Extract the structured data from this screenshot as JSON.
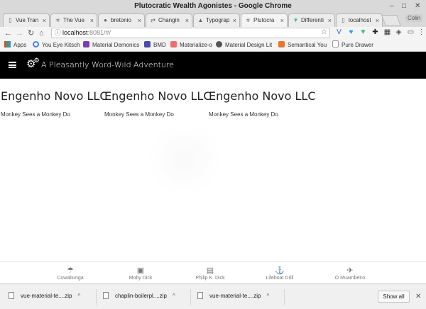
{
  "window": {
    "title": "Plutocratic Wealth Agonistes - Google Chrome",
    "min": "–",
    "max": "□",
    "close": "✕"
  },
  "tabs": [
    {
      "label": "Vue Tran",
      "icon": "page-icon",
      "glyph": "▯"
    },
    {
      "label": "The Vue",
      "icon": "biohazard-icon",
      "glyph": "☣"
    },
    {
      "label": "bretonio",
      "icon": "github-icon",
      "glyph": "●"
    },
    {
      "label": "Changin",
      "icon": "swap-icon",
      "glyph": "⇄"
    },
    {
      "label": "Typograp",
      "icon": "type-icon",
      "glyph": "▲"
    },
    {
      "label": "Plutocra",
      "icon": "biohazard-icon",
      "glyph": "☣"
    },
    {
      "label": "Differenti",
      "icon": "vue-icon",
      "glyph": "▼"
    },
    {
      "label": "localhost",
      "icon": "page-icon",
      "glyph": "▯"
    }
  ],
  "user_button": "Colin",
  "address": {
    "host": "localhost",
    "path": ":8081/#/"
  },
  "bookmarks": [
    {
      "label": "Apps",
      "icon": "apps-grid-icon",
      "color": "#e94235"
    },
    {
      "label": "You Eye Kitsch",
      "icon": "spinner-icon",
      "color": "#4285f4"
    },
    {
      "label": "Material Demonics",
      "icon": "material-icon",
      "color": "#7b3fb0"
    },
    {
      "label": "BMD",
      "icon": "bmd-icon",
      "color": "#4a4aa8"
    },
    {
      "label": "Materialize-o",
      "icon": "materialize-icon",
      "color": "#ee6e73"
    },
    {
      "label": "Material Design Lit",
      "icon": "md-lite-icon",
      "color": "#555555"
    },
    {
      "label": "Semantical You",
      "icon": "semantic-icon",
      "color": "#e8742f"
    },
    {
      "label": "Pure Drawer",
      "icon": "page-icon",
      "color": "#dddddd"
    }
  ],
  "app": {
    "title": "A Pleasantly Word-Wild Adventure"
  },
  "cards": [
    {
      "company": "Engenho Novo LLC",
      "tagline": "Monkey Sees a Monkey Do"
    },
    {
      "company": "Engenho Novo LLC",
      "tagline": "Monkey Sees a Monkey Do"
    },
    {
      "company": "Engenho Novo LLC",
      "tagline": "Monkey Sees a Monkey Do"
    }
  ],
  "bottom_nav": [
    {
      "label": "Cowabunga",
      "icon": "umbrella-icon",
      "glyph": "☂"
    },
    {
      "label": "Moby Dick",
      "icon": "bus-icon",
      "glyph": "▣"
    },
    {
      "label": "Philip K. Dick",
      "icon": "book-icon",
      "glyph": "▤"
    },
    {
      "label": "Lifeboat Drill",
      "icon": "rowing-icon",
      "glyph": "⚓"
    },
    {
      "label": "O Muambeiro",
      "icon": "airplane-icon",
      "glyph": "✈"
    }
  ],
  "downloads": [
    {
      "name": "vue-material-te....zip"
    },
    {
      "name": "chaplin-boilerpl....zip"
    },
    {
      "name": "vue-material-te....zip"
    }
  ],
  "show_all": "Show all"
}
